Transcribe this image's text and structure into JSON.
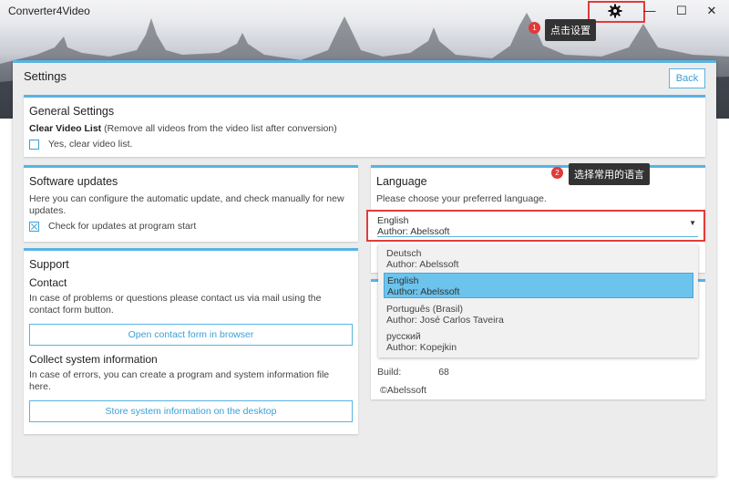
{
  "window": {
    "title": "Converter4Video",
    "minimize": "—",
    "maximize": "☐",
    "close": "✕"
  },
  "callouts": {
    "one": {
      "num": "1",
      "text": "点击设置"
    },
    "two": {
      "num": "2",
      "text": "选择常用的语言"
    }
  },
  "page": {
    "title": "Settings",
    "back_label": "Back"
  },
  "general": {
    "title": "General Settings",
    "clear_label": "Clear Video List",
    "clear_desc": " (Remove all videos from the video list after conversion)",
    "clear_option": "Yes, clear video list.",
    "clear_checked": false
  },
  "updates": {
    "title": "Software updates",
    "desc": "Here you can configure the automatic update, and check manually for new updates.",
    "check_option": "Check for updates at program start",
    "check_checked": true
  },
  "support": {
    "title": "Support",
    "contact_title": "Contact",
    "contact_desc": "In case of problems or questions please contact us via mail using the contact form button.",
    "contact_button": "Open contact form in browser",
    "collect_title": "Collect system information",
    "collect_desc": "In case of errors, you can create a program and system information file here.",
    "collect_button": "Store system information on the desktop"
  },
  "language": {
    "title": "Language",
    "desc": "Please choose your preferred language.",
    "selected": {
      "name": "English",
      "author": "Author: Abelssoft"
    },
    "options": [
      {
        "name": "Deutsch",
        "author": "Author: Abelssoft"
      },
      {
        "name": "English",
        "author": "Author: Abelssoft"
      },
      {
        "name": "Português (Brasil)",
        "author": "Author: José Carlos Taveira"
      },
      {
        "name": "русский",
        "author": "Author: Kopejkin"
      }
    ]
  },
  "info": {
    "build_label": "Build:",
    "build_value": "68",
    "copyright": "©Abelssoft"
  },
  "colors": {
    "accent": "#58b3e4",
    "highlight": "#e03c3c",
    "selected_option": "#6cc3ec"
  }
}
